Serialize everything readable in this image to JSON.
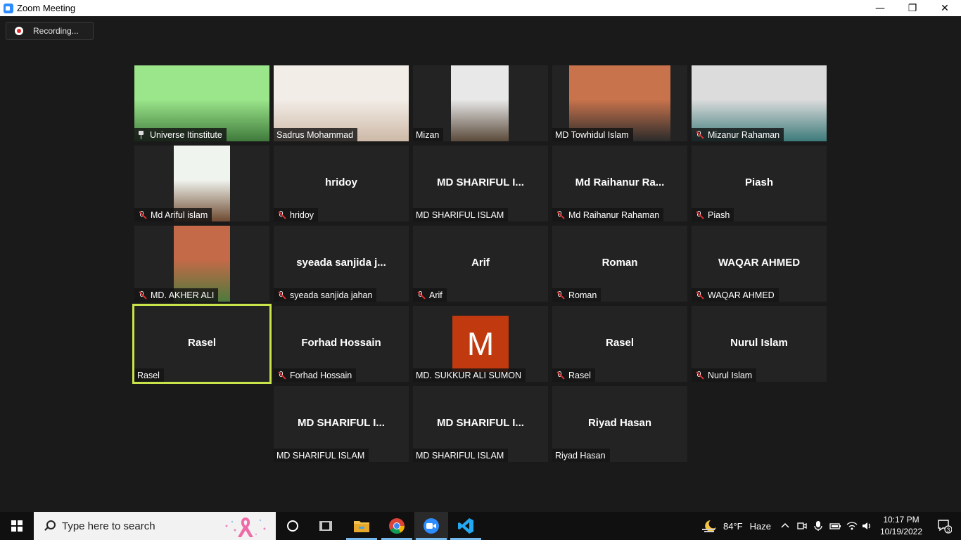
{
  "window": {
    "title": "Zoom Meeting",
    "minimize": "—",
    "restore": "❐",
    "close": "✕"
  },
  "recording": {
    "label": "Recording..."
  },
  "tiles": [
    {
      "big": "",
      "label": "Universe Itinstitute"
    },
    {
      "big": "",
      "label": "Sadrus Mohammad"
    },
    {
      "big": "",
      "label": "Mizan"
    },
    {
      "big": "",
      "label": "MD Towhidul Islam"
    },
    {
      "big": "",
      "label": "Mizanur Rahaman"
    },
    {
      "big": "",
      "label": "Md Ariful islam"
    },
    {
      "big": "hridoy",
      "label": "hridoy"
    },
    {
      "big": "MD SHARIFUL I...",
      "label": "MD SHARIFUL ISLAM"
    },
    {
      "big": "Md  Raihanur  Ra...",
      "label": "Md Raihanur Rahaman"
    },
    {
      "big": "Piash",
      "label": "Piash"
    },
    {
      "big": "",
      "label": "MD. AKHER ALI"
    },
    {
      "big": "syeada  sanjida  j...",
      "label": "syeada sanjida jahan"
    },
    {
      "big": "Arif",
      "label": "Arif"
    },
    {
      "big": "Roman",
      "label": "Roman"
    },
    {
      "big": "WAQAR AHMED",
      "label": "WAQAR AHMED"
    },
    {
      "big": "Rasel",
      "label": "Rasel"
    },
    {
      "big": "Forhad Hossain",
      "label": "Forhad Hossain"
    },
    {
      "big": "",
      "label": "MD. SUKKUR ALI SUMON",
      "avatar": "M"
    },
    {
      "big": "Rasel",
      "label": "Rasel"
    },
    {
      "big": "Nurul Islam",
      "label": "Nurul Islam"
    },
    {
      "big": "MD SHARIFUL I...",
      "label": "MD SHARIFUL ISLAM"
    },
    {
      "big": "MD SHARIFUL I...",
      "label": "MD SHARIFUL ISLAM"
    },
    {
      "big": "Riyad Hasan",
      "label": "Riyad Hasan"
    }
  ],
  "taskbar": {
    "search_placeholder": "Type here to search",
    "weather_temp": "84°F",
    "weather_desc": "Haze",
    "time": "10:17 PM",
    "date": "10/19/2022",
    "notification_count": "3"
  },
  "colors": {
    "active_speaker": "#c9e44a",
    "avatar_bg": "#c0390f",
    "mute_slash": "#e53030",
    "taskbar_accent": "#76b9ed"
  }
}
